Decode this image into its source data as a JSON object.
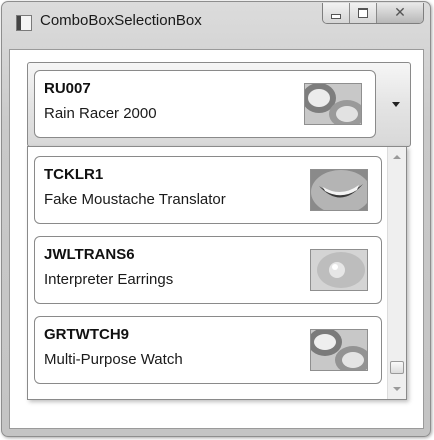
{
  "window": {
    "title": "ComboBoxSelectionBox"
  },
  "combo": {
    "selected": {
      "code": "RU007",
      "name": "Rain Racer 2000",
      "thumb_icon": "racer-product-icon"
    }
  },
  "dropdown": {
    "items": [
      {
        "code": "TCKLR1",
        "name": "Fake Moustache Translator",
        "thumb_icon": "smile-product-icon"
      },
      {
        "code": "JWLTRANS6",
        "name": "Interpreter Earrings",
        "thumb_icon": "earring-product-icon"
      },
      {
        "code": "GRTWTCH9",
        "name": "Multi-Purpose Watch",
        "thumb_icon": "watch-product-icon"
      }
    ]
  }
}
